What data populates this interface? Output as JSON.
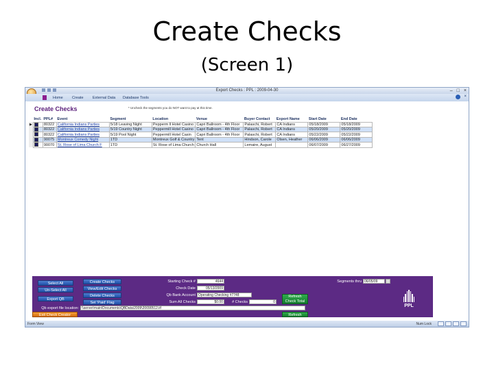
{
  "slide": {
    "title": "Create Checks",
    "subtitle": "(Screen 1)"
  },
  "window": {
    "title": "Export Checks : PPL : 2009-04-30"
  },
  "ribbon": {
    "tabs": [
      "Home",
      "Create",
      "External Data",
      "Database Tools"
    ]
  },
  "form": {
    "title": "Create Checks",
    "hint": "* Uncheck the segments you do NOT want to pay at this time.",
    "columns": [
      "Incl.",
      "PPL#",
      "Event",
      "Segment",
      "Location",
      "Venue",
      "Buyer Contact",
      "Export Name",
      "Start Date",
      "End Date"
    ],
    "rows": [
      [
        "80322",
        "California Indians Parties",
        "5/18 Leaving Night",
        "Pepperm ll Hotel Casino",
        "Capri Ballroom - 4th Floor",
        "Palaschi, Robert",
        "CA Indians",
        "05/18/2009",
        "05/18/2009"
      ],
      [
        "80322",
        "California Indians Parties",
        "5/19 Country Night",
        "Peppermill Hotel Casino",
        "Capri Ballroom - 4th Floor",
        "Palaschi, Robert",
        "CA Indians",
        "05/20/2009",
        "05/20/2009"
      ],
      [
        "80322",
        "California Indians Parties",
        "5/19 Pool Night",
        "Peppermill Hotel Casin",
        "Capri Ballroom - 4th Floor",
        "Palaschi, Robert",
        "CA Indians",
        "05/22/2009",
        "05/22/2009"
      ],
      [
        "90075",
        "Montreux Comedy Night",
        "1TD",
        "Montreux Golf & Country",
        "Tent",
        "Hindson, Carole",
        "Olsen, Heather",
        "06/06/2009",
        "06/06/2009"
      ],
      [
        "90070",
        "St. Rose of Lima Church F",
        "1TD",
        "St. Rose of Lima Church",
        "Church Hall",
        "Lemaire, August",
        "",
        "06/07/2009",
        "06/27/2009"
      ]
    ]
  },
  "panel": {
    "select_all": "Select All",
    "unselect_all": "Un-Select All",
    "export_qb": "Export QB",
    "create_checks": "Create Checks",
    "view_edit_checks": "View/Edit Checks",
    "delete_checks": "Delete Checks",
    "set_paid_flag": "Set 'Paid' Flag",
    "starting_check_label": "Starting Check #",
    "starting_check_value": "4644",
    "check_date_label": "Check Date",
    "check_date_value": "05/13/2009",
    "qb_bank_label": "Qb Bank Account",
    "qb_bank_value": "Operating Checking #7748",
    "sum_label": "Sum All Checks",
    "sum_value": "$0.00",
    "num_checks_label": "# Checks",
    "num_checks_value": "0",
    "refresh_total": "Refresh Check Total",
    "segments_label": "Segments thru",
    "segments_value": "06/05/09",
    "qb_file_label": "Qb export file location:",
    "qb_file_value": "\\\\server\\main\\Documents\\QBData\\2009\\20090512.iif",
    "exit": "Exit Check Creator",
    "refresh": "Refresh",
    "logo_text": "PPL"
  },
  "status": {
    "left": "Form View",
    "right": "Num Lock"
  }
}
